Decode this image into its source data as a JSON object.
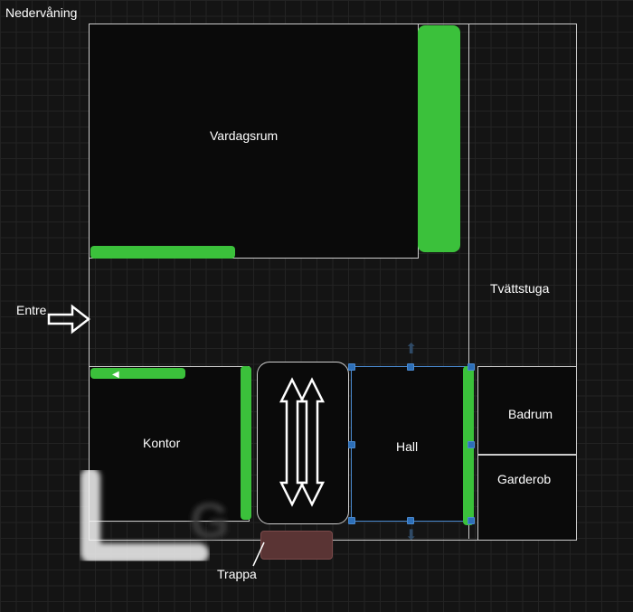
{
  "title": "Nedervåning",
  "entry_label": "Entre",
  "rooms": {
    "vardagsrum": "Vardagsrum",
    "kontor": "Kontor",
    "hall": "Hall",
    "tvattstuga": "Tvättstuga",
    "badrum": "Badrum",
    "garderob": "Garderob",
    "trappa": "Trappa"
  },
  "annotation": "G",
  "colors": {
    "accent": "#3bc13b",
    "selection": "#2d6fb8",
    "brown": "#5a3434"
  }
}
